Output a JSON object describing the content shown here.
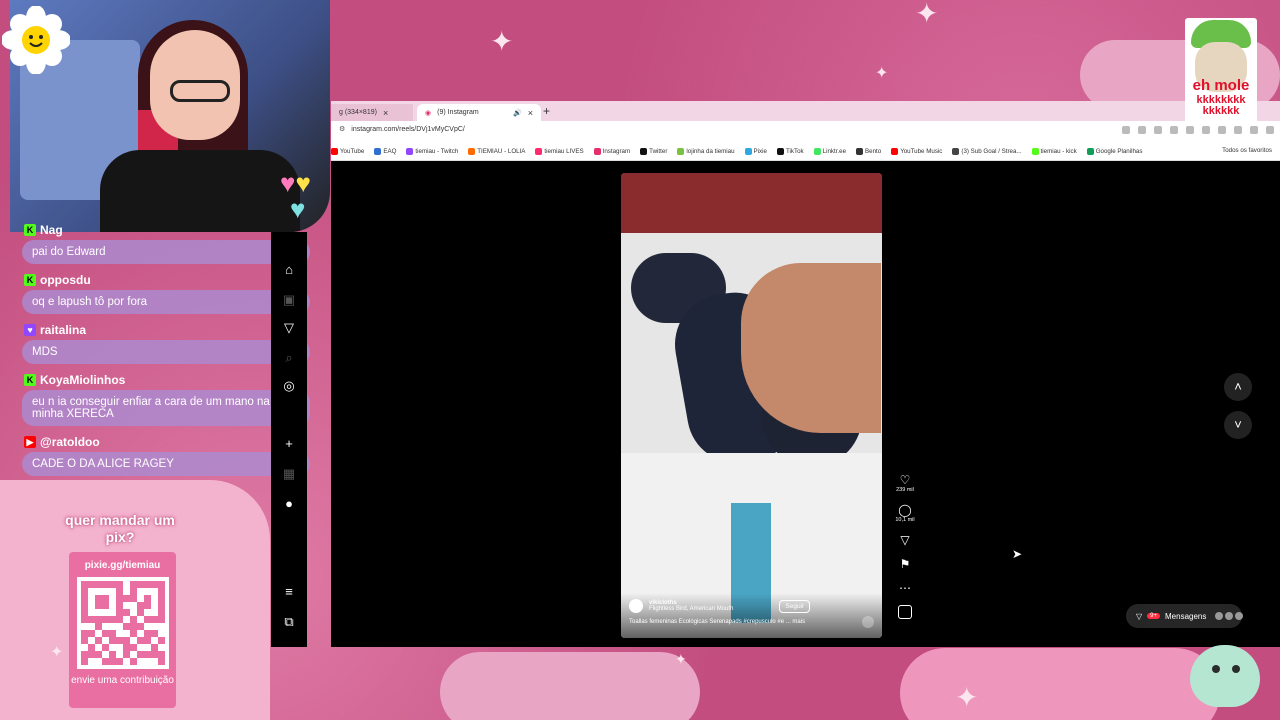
{
  "chat": {
    "messages": [
      {
        "platform": "kick",
        "user": "Nag",
        "text": "pai do Edward"
      },
      {
        "platform": "kick",
        "user": "opposdu",
        "text": "oq e lapush tô por fora"
      },
      {
        "platform": "twitch",
        "user": "raitalina",
        "text": "MDS"
      },
      {
        "platform": "kick",
        "user": "KoyaMiolinhos",
        "text": "eu n ia conseguir enfiar a cara de um mano na minha XERECA"
      },
      {
        "platform": "youtube",
        "user": "@ratoldoo",
        "text": "CADE O DA ALICE RAGEY"
      }
    ]
  },
  "pix": {
    "title": "quer mandar um pix?",
    "url": "pixie.gg/tiemiau",
    "footer": "envie uma contribuição"
  },
  "browser": {
    "tabs": [
      {
        "label": "g (334×819)"
      },
      {
        "label": "(9) Instagram"
      }
    ],
    "url": "instagram.com/reels/DVj1vMyCVpC/",
    "bookmarks": [
      {
        "label": "YouTube",
        "color": "#ff0000"
      },
      {
        "label": "EAQ",
        "color": "#2f6fd1"
      },
      {
        "label": "tiemiau - Twitch",
        "color": "#9146ff"
      },
      {
        "label": "TIEMIAU - LOLIA",
        "color": "#ff6a00"
      },
      {
        "label": "tiemiau LIVES",
        "color": "#ff2a6d"
      },
      {
        "label": "Instagram",
        "color": "#e1306c"
      },
      {
        "label": "Twitter",
        "color": "#111111"
      },
      {
        "label": "lojinha da tiemiau",
        "color": "#7ac142"
      },
      {
        "label": "Pixie",
        "color": "#2fa8e0"
      },
      {
        "label": "TikTok",
        "color": "#111111"
      },
      {
        "label": "Linktr.ee",
        "color": "#43e660"
      },
      {
        "label": "Bento",
        "color": "#333333"
      },
      {
        "label": "YouTube Music",
        "color": "#ff0000"
      },
      {
        "label": "(3) Sub Goal / Strea...",
        "color": "#444444"
      },
      {
        "label": "tiemiau - kick",
        "color": "#53fc18"
      },
      {
        "label": "Google Planilhas",
        "color": "#0f9d58"
      }
    ],
    "all_favorites": "Todos os favoritos"
  },
  "reel": {
    "username": "vikicloths",
    "audio": "Flightless Bird, American Mouth",
    "follow_label": "Seguir",
    "caption": "Toallas femeninas Ecológicas Serenapads #crepusculo #e ... mais",
    "likes": "239 mil",
    "comments": "10,1 mil"
  },
  "messages_label": "Mensagens",
  "messages_badge": "9+",
  "sticker": {
    "line1": "eh mole",
    "line2": "kkkkkkkk kkkkkk"
  },
  "colors": {
    "background": "#c24d7e",
    "chat_bubble": "#aa8cd2",
    "pix_card": "#e96fa2"
  }
}
